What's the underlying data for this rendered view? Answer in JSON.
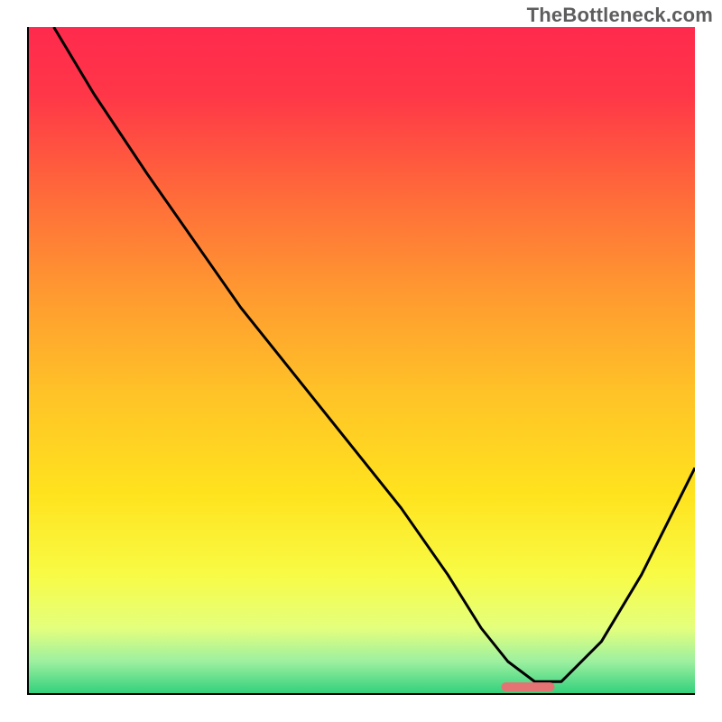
{
  "watermark": "TheBottleneck.com",
  "chart_data": {
    "type": "line",
    "title": "",
    "xlabel": "",
    "ylabel": "",
    "xlim": [
      0,
      100
    ],
    "ylim": [
      0,
      100
    ],
    "background_gradient": [
      {
        "offset": 0.0,
        "color": "#ff2a4d"
      },
      {
        "offset": 0.1,
        "color": "#ff3648"
      },
      {
        "offset": 0.25,
        "color": "#ff6a3a"
      },
      {
        "offset": 0.4,
        "color": "#ff9a30"
      },
      {
        "offset": 0.55,
        "color": "#ffc327"
      },
      {
        "offset": 0.7,
        "color": "#ffe31e"
      },
      {
        "offset": 0.82,
        "color": "#f8fb45"
      },
      {
        "offset": 0.9,
        "color": "#e4ff7d"
      },
      {
        "offset": 0.95,
        "color": "#9cf0a0"
      },
      {
        "offset": 1.0,
        "color": "#2ecf7a"
      }
    ],
    "series": [
      {
        "name": "bottleneck-curve",
        "color": "#000000",
        "x": [
          4,
          10,
          18,
          25,
          32,
          40,
          48,
          56,
          63,
          68,
          72,
          76,
          80,
          86,
          92,
          100
        ],
        "y": [
          100,
          90,
          78,
          68,
          58,
          48,
          38,
          28,
          18,
          10,
          5,
          2,
          2,
          8,
          18,
          34
        ]
      }
    ],
    "optimal_marker": {
      "x_start": 71,
      "x_end": 79,
      "y": 1.2,
      "color": "#e57373",
      "thickness": 10
    },
    "axes_color": "#000000"
  }
}
